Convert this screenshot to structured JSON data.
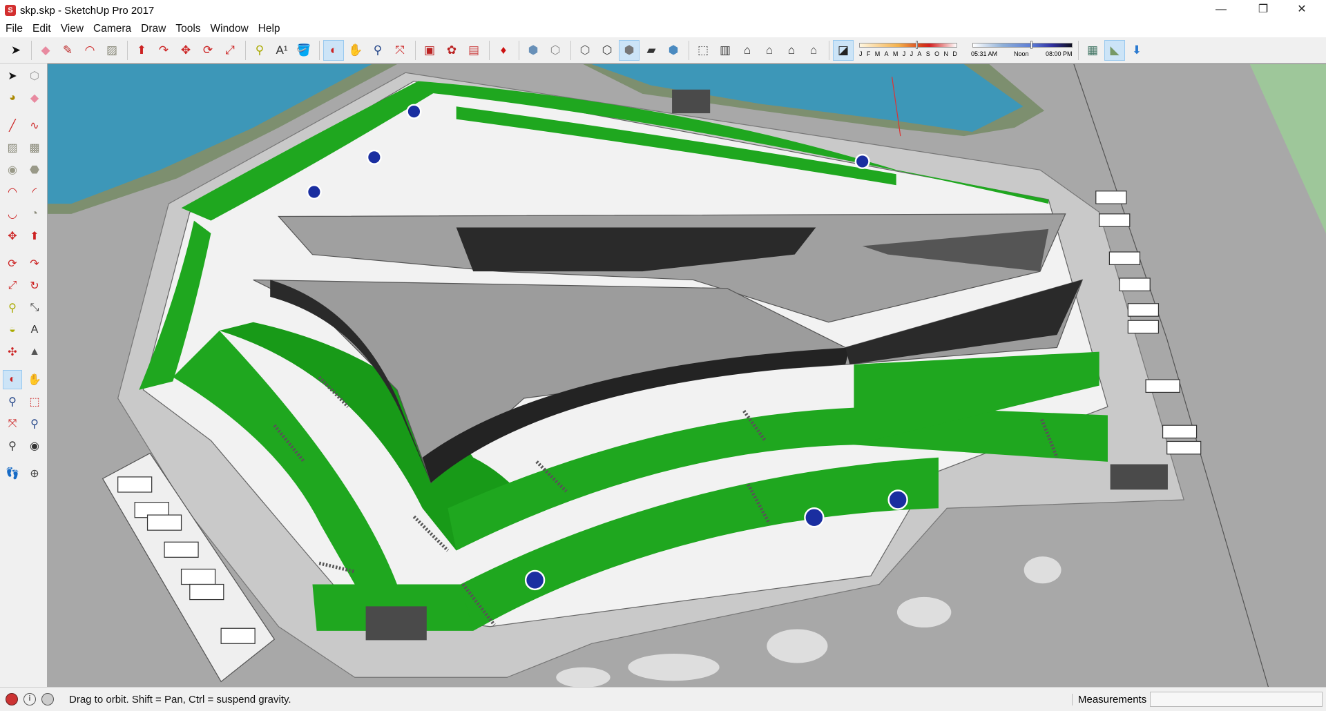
{
  "window": {
    "title": "skp.skp - SketchUp Pro 2017",
    "minimize": "—",
    "restore": "❐",
    "close": "✕"
  },
  "menu": [
    "File",
    "Edit",
    "View",
    "Camera",
    "Draw",
    "Tools",
    "Window",
    "Help"
  ],
  "toolbar": {
    "icons": [
      {
        "name": "select-icon",
        "glyph": "➤",
        "color": "#111"
      },
      {
        "sep": true
      },
      {
        "name": "eraser-icon",
        "glyph": "◆",
        "color": "#e88aa0"
      },
      {
        "name": "pencil-icon",
        "glyph": "✎",
        "color": "#b22"
      },
      {
        "name": "arc-icon",
        "glyph": "◠",
        "color": "#c22"
      },
      {
        "name": "rectangle-icon",
        "glyph": "▨",
        "color": "#8a8a7a"
      },
      {
        "sep": true
      },
      {
        "name": "push-pull-icon",
        "glyph": "⬆",
        "color": "#c22"
      },
      {
        "name": "follow-me-icon",
        "glyph": "↷",
        "color": "#c22"
      },
      {
        "name": "move-icon",
        "glyph": "✥",
        "color": "#c22"
      },
      {
        "name": "rotate-icon",
        "glyph": "⟳",
        "color": "#c22"
      },
      {
        "name": "scale-icon",
        "glyph": "⤢",
        "color": "#c22"
      },
      {
        "sep": true
      },
      {
        "name": "tape-measure-icon",
        "glyph": "⚲",
        "color": "#aa0"
      },
      {
        "name": "text-icon",
        "glyph": "A¹",
        "color": "#333"
      },
      {
        "name": "paint-bucket-icon",
        "glyph": "🪣",
        "color": "#664"
      },
      {
        "sep": true
      },
      {
        "name": "orbit-icon",
        "glyph": "◐",
        "color": "#c22",
        "active": true
      },
      {
        "name": "pan-icon",
        "glyph": "✋",
        "color": "#c9a"
      },
      {
        "name": "zoom-icon",
        "glyph": "⚲",
        "color": "#248"
      },
      {
        "name": "zoom-extents-icon",
        "glyph": "⤧",
        "color": "#c22"
      },
      {
        "sep": true
      },
      {
        "name": "3d-warehouse-icon",
        "glyph": "▣",
        "color": "#b22"
      },
      {
        "name": "extension-warehouse-icon",
        "glyph": "✿",
        "color": "#b22"
      },
      {
        "name": "share-model-icon",
        "glyph": "▤",
        "color": "#c44"
      },
      {
        "sep": true
      },
      {
        "name": "ruby-console-icon",
        "glyph": "♦",
        "color": "#c11"
      },
      {
        "sep": true
      },
      {
        "name": "xray-style-icon",
        "glyph": "⬢",
        "color": "#6890b8"
      },
      {
        "name": "wireframe-style-icon",
        "glyph": "⬡",
        "color": "#888"
      },
      {
        "sep": true
      },
      {
        "name": "hidden-line-style-icon",
        "glyph": "⬡",
        "color": "#555"
      },
      {
        "name": "shaded-style-icon",
        "glyph": "⬡",
        "color": "#333"
      },
      {
        "name": "shaded-textures-style-icon",
        "glyph": "⬢",
        "color": "#777",
        "active": true
      },
      {
        "name": "monochrome-style-icon",
        "glyph": "▰",
        "color": "#333"
      },
      {
        "name": "back-edges-icon",
        "glyph": "⬢",
        "color": "#4a8ac0"
      },
      {
        "sep": true
      },
      {
        "name": "iso-view-icon",
        "glyph": "⬚",
        "color": "#444"
      },
      {
        "name": "top-view-icon",
        "glyph": "▥",
        "color": "#444"
      },
      {
        "name": "front-view-icon",
        "glyph": "⌂",
        "color": "#222"
      },
      {
        "name": "right-view-icon",
        "glyph": "⌂",
        "color": "#444"
      },
      {
        "name": "back-view-icon",
        "glyph": "⌂",
        "color": "#222"
      },
      {
        "name": "left-view-icon",
        "glyph": "⌂",
        "color": "#444"
      },
      {
        "sep": true
      },
      {
        "name": "shadows-toggle-icon",
        "glyph": "◪",
        "color": "#222",
        "active": true
      }
    ],
    "shadows": {
      "months": [
        "J",
        "F",
        "M",
        "A",
        "M",
        "J",
        "J",
        "A",
        "S",
        "O",
        "N",
        "D"
      ],
      "month_position": 0.58,
      "time_start": "05:31 AM",
      "time_mid": "Noon",
      "time_end": "08:00 PM",
      "time_position": 0.58
    },
    "right_icons": [
      {
        "name": "add-location-icon",
        "glyph": "▦",
        "color": "#476"
      },
      {
        "name": "toggle-terrain-icon",
        "glyph": "◣",
        "color": "#796",
        "active": true
      },
      {
        "name": "get-photo-texture-icon",
        "glyph": "⬇",
        "color": "#2a7ad0"
      }
    ]
  },
  "left_toolbar": [
    [
      "select-icon",
      "➤",
      "#111"
    ],
    [
      "make-component-icon",
      "⬡",
      "#999"
    ],
    [
      "paint-bucket-icon",
      "◕",
      "#a80"
    ],
    [
      "eraser-icon",
      "◆",
      "#e88aa0"
    ],
    [
      "line-icon",
      "╱",
      "#c22"
    ],
    [
      "freehand-icon",
      "∿",
      "#c22"
    ],
    [
      "rectangle-icon",
      "▨",
      "#887"
    ],
    [
      "rotated-rectangle-icon",
      "▩",
      "#887"
    ],
    [
      "circle-icon",
      "◉",
      "#998"
    ],
    [
      "polygon-icon",
      "⬣",
      "#998"
    ],
    [
      "arc-icon",
      "◠",
      "#c22"
    ],
    [
      "two-point-arc-icon",
      "◜",
      "#c22"
    ],
    [
      "three-point-arc-icon",
      "◡",
      "#c22"
    ],
    [
      "pie-icon",
      "◔",
      "#887"
    ],
    [
      "move-icon",
      "✥",
      "#c22"
    ],
    [
      "push-pull-icon",
      "⬆",
      "#c22"
    ],
    [
      "rotate-icon",
      "⟳",
      "#c22"
    ],
    [
      "follow-me-icon",
      "↷",
      "#c22"
    ],
    [
      "scale-icon",
      "⤢",
      "#c22"
    ],
    [
      "offset-icon",
      "↻",
      "#c22"
    ],
    [
      "tape-measure-icon",
      "⚲",
      "#aa0"
    ],
    [
      "dimension-icon",
      "⤡",
      "#333"
    ],
    [
      "protractor-icon",
      "◒",
      "#aa0"
    ],
    [
      "text-icon",
      "A",
      "#333"
    ],
    [
      "axes-icon",
      "✣",
      "#c22"
    ],
    [
      "3d-text-icon",
      "▲",
      "#555"
    ],
    [
      "orbit-icon",
      "◐",
      "#c22",
      true
    ],
    [
      "pan-icon",
      "✋",
      "#c9a"
    ],
    [
      "zoom-icon",
      "⚲",
      "#248"
    ],
    [
      "zoom-window-icon",
      "⬚",
      "#c22"
    ],
    [
      "zoom-extents-icon",
      "⤧",
      "#c22"
    ],
    [
      "previous-view-icon",
      "⚲",
      "#248"
    ],
    [
      "position-camera-icon",
      "⚲",
      "#333"
    ],
    [
      "look-around-icon",
      "◉",
      "#333"
    ],
    [
      "walk-icon",
      "👣",
      "#222"
    ],
    [
      "section-plane-icon",
      "⊕",
      "#444"
    ]
  ],
  "status": {
    "icons": [
      "geo-location-icon",
      "credits-icon",
      "user-icon"
    ],
    "hint": "Drag to orbit. Shift = Pan, Ctrl = suspend gravity.",
    "measurements_label": "Measurements",
    "measurements_value": ""
  },
  "colors": {
    "water": "#3d97b8",
    "grass": "#1fa71f",
    "plaza": "#f2f2f2",
    "ground": "#a6a6a6",
    "wall_dark": "#2a2a2a",
    "wall_gray": "#9c9c9c"
  }
}
